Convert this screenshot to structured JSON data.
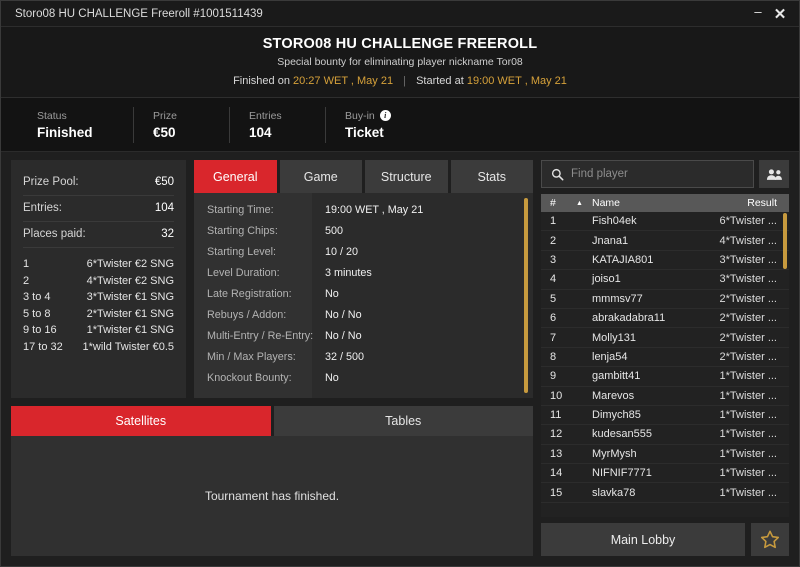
{
  "window": {
    "title": "Storo08 HU CHALLENGE Freeroll #1001511439",
    "minimize_label": "–",
    "close_label": "✕"
  },
  "header": {
    "title": "STORO08 HU CHALLENGE FREEROLL",
    "subtitle": "Special bounty for eliminating player nickname Tor08",
    "finished_label": "Finished on",
    "finished_time": "20:27 WET , May 21",
    "divider": "|",
    "started_label": "Started at",
    "started_time": "19:00 WET , May 21",
    "accent_gold": "#d6a13a"
  },
  "status": {
    "cells": [
      {
        "label": "Status",
        "value": "Finished",
        "has_info": false
      },
      {
        "label": "Prize",
        "value": "€50",
        "has_info": false
      },
      {
        "label": "Entries",
        "value": "104",
        "has_info": false
      },
      {
        "label": "Buy-in",
        "value": "Ticket",
        "has_info": true
      }
    ]
  },
  "prize_panel": {
    "rows": [
      {
        "label": "Prize Pool:",
        "value": "€50"
      },
      {
        "label": "Entries:",
        "value": "104"
      },
      {
        "label": "Places paid:",
        "value": "32"
      }
    ],
    "payouts": [
      {
        "place": "1",
        "prize": "6*Twister €2 SNG"
      },
      {
        "place": "2",
        "prize": "4*Twister €2 SNG"
      },
      {
        "place": "3  to  4",
        "prize": "3*Twister €1 SNG"
      },
      {
        "place": "5  to  8",
        "prize": "2*Twister €1 SNG"
      },
      {
        "place": "9  to  16",
        "prize": "1*Twister €1 SNG"
      },
      {
        "place": "17  to  32",
        "prize": "1*wild Twister €0.5"
      }
    ]
  },
  "tabs": {
    "items": [
      {
        "label": "General",
        "active": true
      },
      {
        "label": "Game",
        "active": false
      },
      {
        "label": "Structure",
        "active": false
      },
      {
        "label": "Stats",
        "active": false
      }
    ]
  },
  "general": {
    "rows": [
      {
        "label": "Starting Time:",
        "value": "19:00 WET , May 21"
      },
      {
        "label": "Starting Chips:",
        "value": "500"
      },
      {
        "label": "Starting Level:",
        "value": "10 / 20"
      },
      {
        "label": "Level Duration:",
        "value": "3 minutes"
      },
      {
        "label": "Late Registration:",
        "value": "No"
      },
      {
        "label": "Rebuys / Addon:",
        "value": "No / No"
      },
      {
        "label": "Multi-Entry / Re-Entry:",
        "value": "No / No"
      },
      {
        "label": "Min / Max Players:",
        "value": "32 / 500"
      },
      {
        "label": "Knockout Bounty:",
        "value": "No"
      }
    ]
  },
  "bottom_tabs": {
    "items": [
      {
        "label": "Satellites",
        "active": true
      },
      {
        "label": "Tables",
        "active": false
      }
    ],
    "message": "Tournament has finished."
  },
  "search": {
    "placeholder": "Find player",
    "value": "",
    "search_icon": "search-icon",
    "people_icon": "people-icon"
  },
  "player_list": {
    "columns": {
      "num": "#",
      "sort": "▲",
      "name": "Name",
      "result": "Result"
    },
    "rows": [
      {
        "num": "1",
        "name": "Fish04ek",
        "result": "6*Twister ..."
      },
      {
        "num": "2",
        "name": "Jnana1",
        "result": "4*Twister ..."
      },
      {
        "num": "3",
        "name": "KATAJIA801",
        "result": "3*Twister ..."
      },
      {
        "num": "4",
        "name": "joiso1",
        "result": "3*Twister ..."
      },
      {
        "num": "5",
        "name": "mmmsv77",
        "result": "2*Twister ..."
      },
      {
        "num": "6",
        "name": "abrakadabra11",
        "result": "2*Twister ..."
      },
      {
        "num": "7",
        "name": "Molly131",
        "result": "2*Twister ..."
      },
      {
        "num": "8",
        "name": "lenja54",
        "result": "2*Twister ..."
      },
      {
        "num": "9",
        "name": "gambitt41",
        "result": "1*Twister ..."
      },
      {
        "num": "10",
        "name": "Marevos",
        "result": "1*Twister ..."
      },
      {
        "num": "11",
        "name": "Dimych85",
        "result": "1*Twister ..."
      },
      {
        "num": "12",
        "name": "kudesan555",
        "result": "1*Twister ..."
      },
      {
        "num": "13",
        "name": "MyrMysh",
        "result": "1*Twister ..."
      },
      {
        "num": "14",
        "name": "NIFNIF7771",
        "result": "1*Twister ..."
      },
      {
        "num": "15",
        "name": "slavka78",
        "result": "1*Twister ..."
      }
    ]
  },
  "footer": {
    "main_lobby_label": "Main Lobby",
    "favorite_icon": "star-icon"
  },
  "colors": {
    "accent_red": "#d9262c",
    "accent_gold": "#c79a3e",
    "panel_bg": "#2b2b2b",
    "window_bg": "#1f1f1f"
  }
}
